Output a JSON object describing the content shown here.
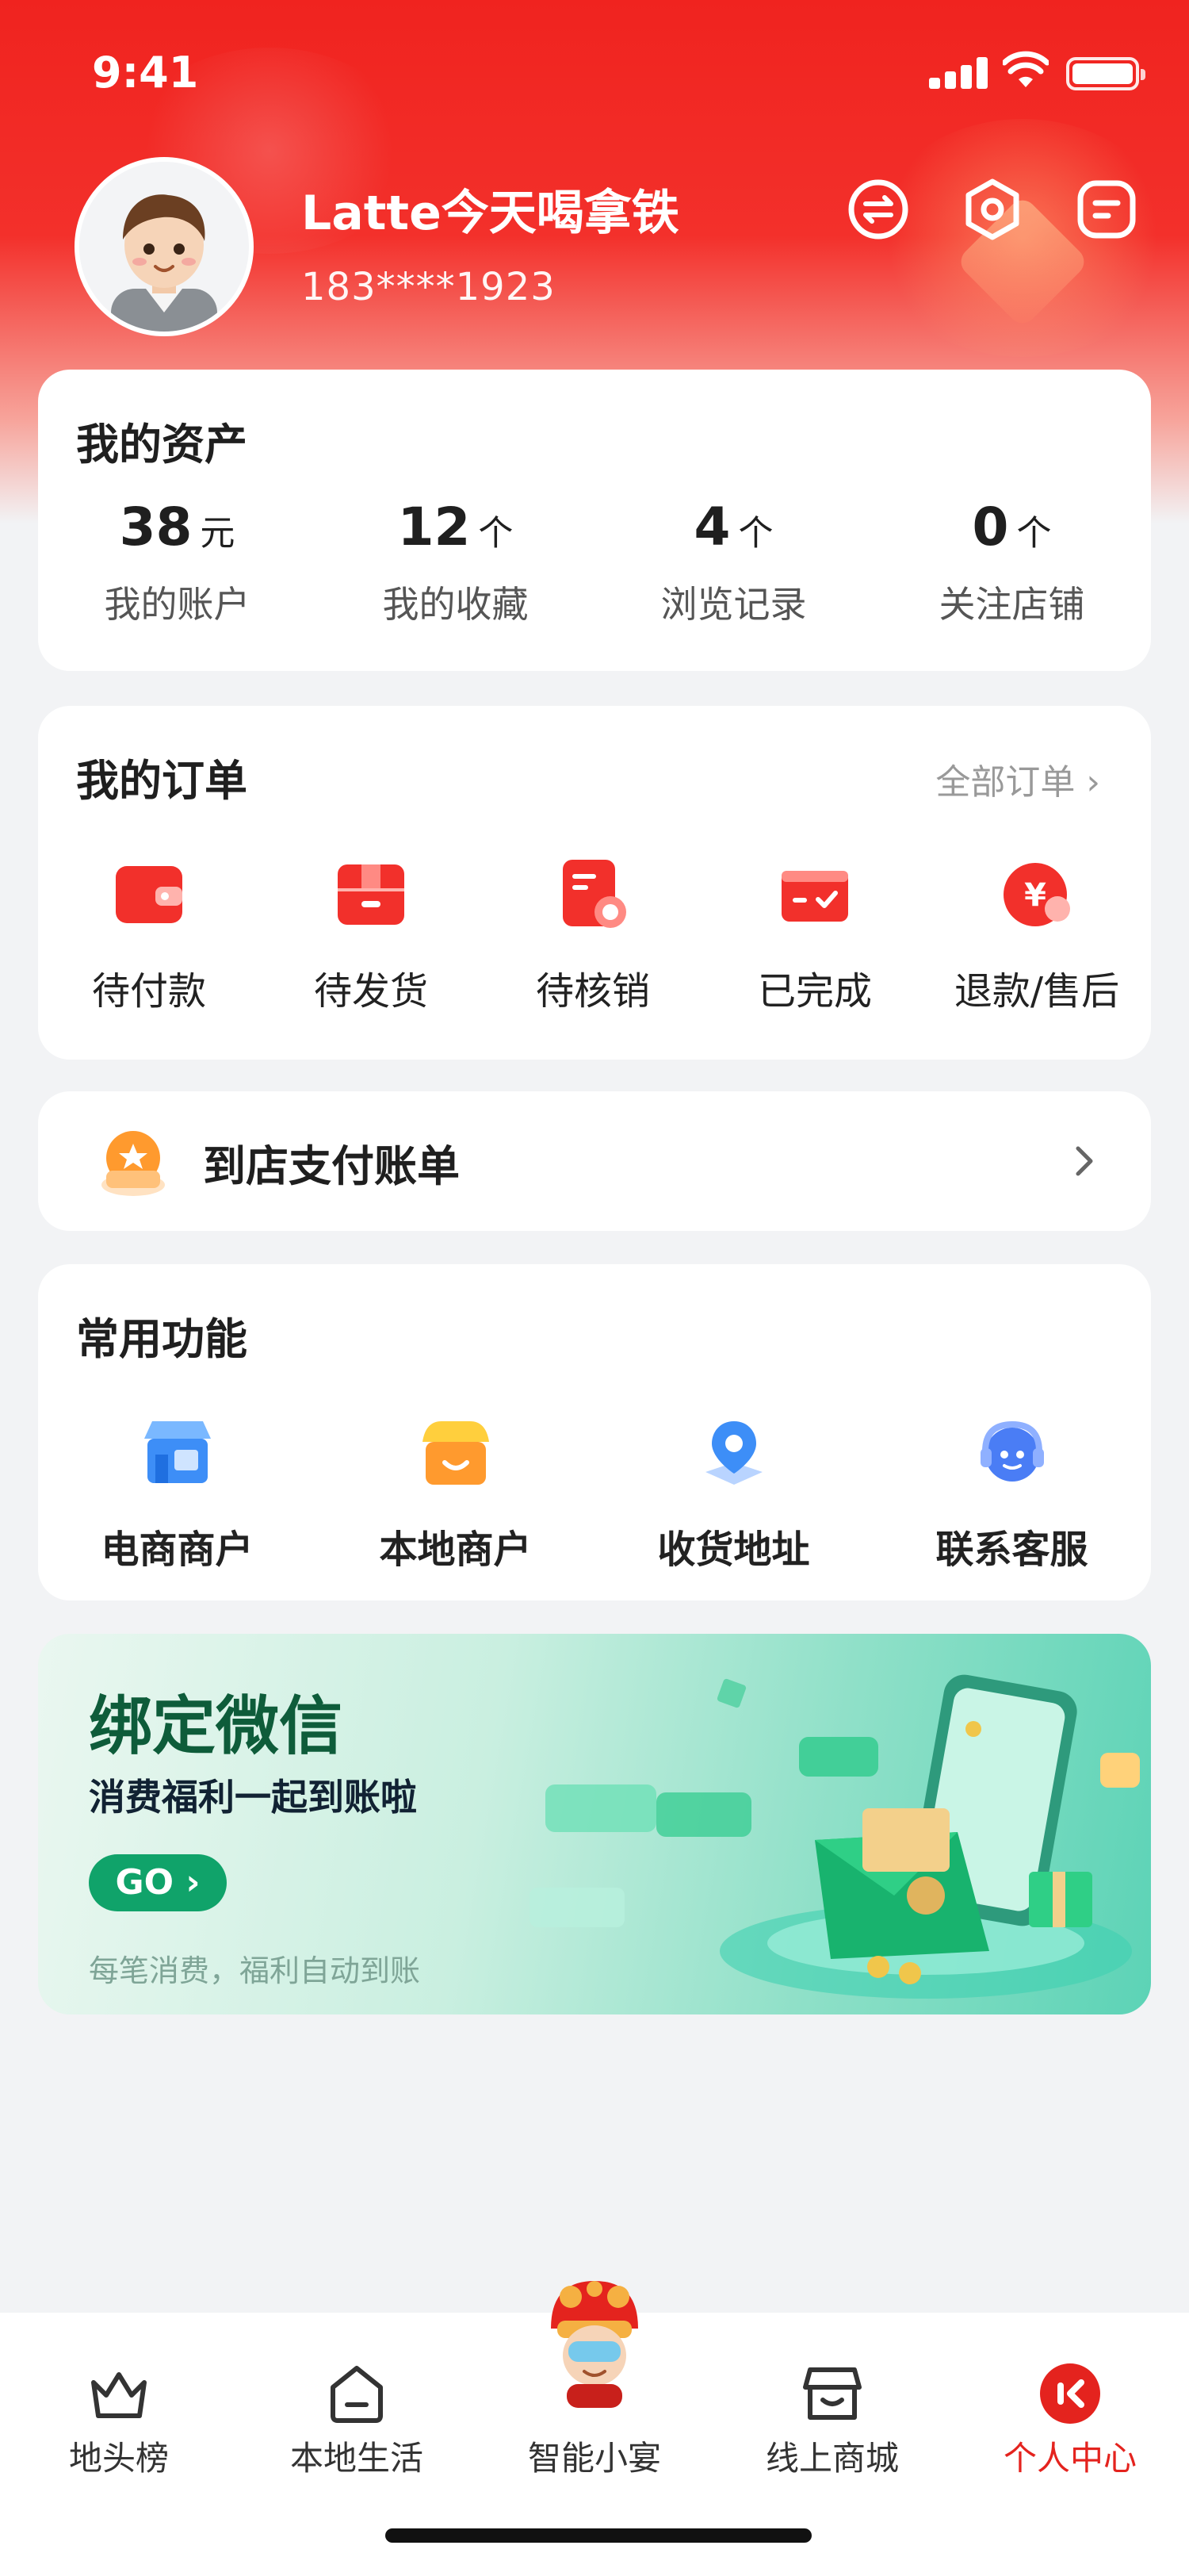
{
  "status_bar": {
    "time": "9:41"
  },
  "profile": {
    "username": "Latte今天喝拿铁",
    "phone": "183****1923",
    "header_icons": [
      "swap-icon",
      "settings-icon",
      "message-icon"
    ]
  },
  "assets": {
    "title": "我的资产",
    "items": [
      {
        "value": "38",
        "unit": "元",
        "label": "我的账户"
      },
      {
        "value": "12",
        "unit": "个",
        "label": "我的收藏"
      },
      {
        "value": "4",
        "unit": "个",
        "label": "浏览记录"
      },
      {
        "value": "0",
        "unit": "个",
        "label": "关注店铺"
      }
    ]
  },
  "orders": {
    "title": "我的订单",
    "all_link": "全部订单 ›",
    "items": [
      {
        "label": "待付款",
        "icon": "wallet-icon"
      },
      {
        "label": "待发货",
        "icon": "package-icon"
      },
      {
        "label": "待核销",
        "icon": "voucher-icon"
      },
      {
        "label": "已完成",
        "icon": "completed-ticket-icon"
      },
      {
        "label": "退款/售后",
        "icon": "refund-icon"
      }
    ]
  },
  "store_pay": {
    "label": "到店支付账单",
    "icon": "store-pay-icon"
  },
  "functions": {
    "title": "常用功能",
    "items": [
      {
        "label": "电商商户",
        "icon": "ecommerce-shop-icon"
      },
      {
        "label": "本地商户",
        "icon": "local-shop-icon"
      },
      {
        "label": "收货地址",
        "icon": "location-pin-icon"
      },
      {
        "label": "联系客服",
        "icon": "customer-service-icon"
      }
    ]
  },
  "banner": {
    "title": "绑定微信",
    "subtitle": "消费福利一起到账啦",
    "button": "GO ›",
    "note": "每笔消费，福利自动到账"
  },
  "tabbar": {
    "items": [
      {
        "label": "地头榜",
        "icon": "crown-icon"
      },
      {
        "label": "本地生活",
        "icon": "local-life-icon"
      },
      {
        "label": "智能小宴",
        "icon": "mascot-lion-icon"
      },
      {
        "label": "线上商城",
        "icon": "online-mall-icon"
      },
      {
        "label": "个人中心",
        "icon": "profile-center-icon"
      }
    ],
    "active_index": 4
  },
  "colors": {
    "primary": "#e4231e",
    "banner_green": "#10a36a"
  }
}
